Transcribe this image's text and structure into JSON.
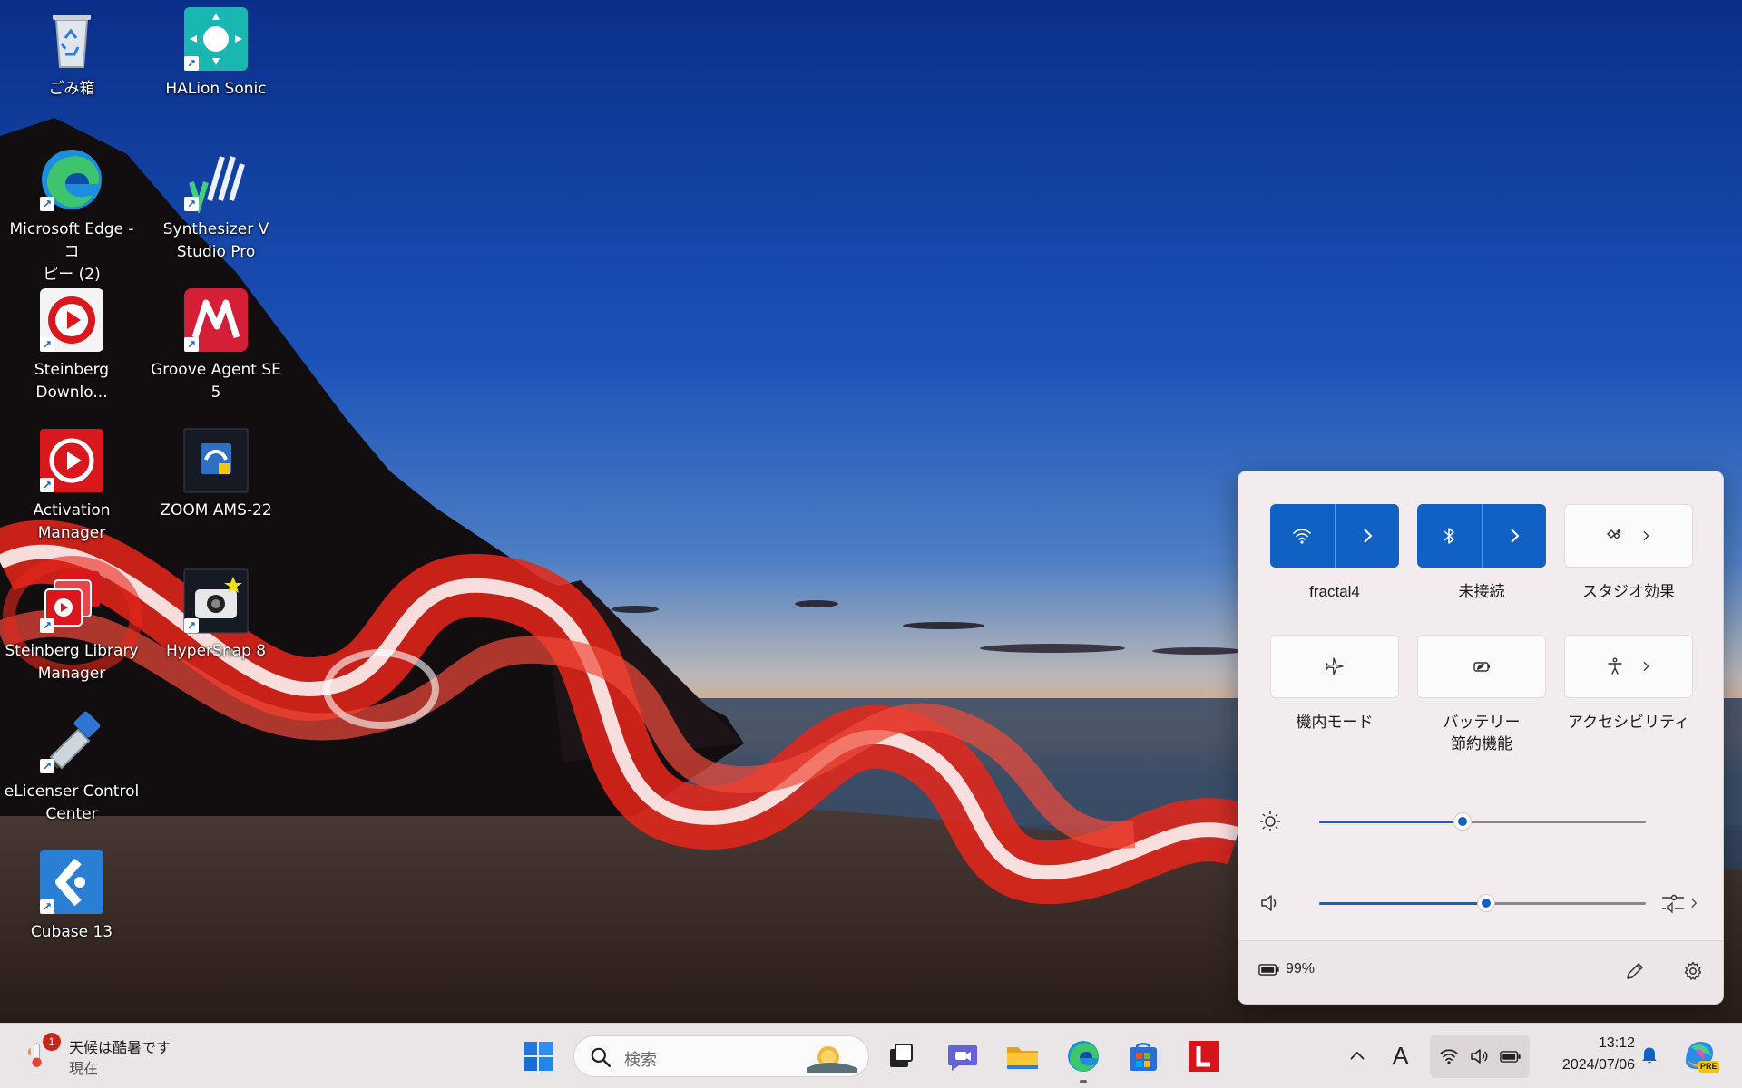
{
  "desktop": {
    "icons": [
      {
        "label": "ごみ箱",
        "icon": "recycle-bin-icon"
      },
      {
        "label": "HALion Sonic",
        "icon": "halion-sonic-icon"
      },
      {
        "label": "Microsoft Edge - コ\nピー (2)",
        "icon": "edge-icon"
      },
      {
        "label": "Synthesizer V\nStudio Pro",
        "icon": "synthesizer-v-icon"
      },
      {
        "label": "Steinberg\nDownlo...",
        "icon": "steinberg-download-icon"
      },
      {
        "label": "Groove Agent SE 5",
        "icon": "groove-agent-icon"
      },
      {
        "label": "Activation Manager",
        "icon": "activation-manager-icon"
      },
      {
        "label": "ZOOM AMS-22",
        "icon": "zoom-ams-icon"
      },
      {
        "label": "Steinberg Library\nManager",
        "icon": "steinberg-library-icon"
      },
      {
        "label": "HyperSnap 8",
        "icon": "hypersnap-icon"
      },
      {
        "label": "eLicenser Control\nCenter",
        "icon": "elicenser-icon"
      },
      {
        "label": "Cubase 13",
        "icon": "cubase-icon"
      }
    ]
  },
  "quick_settings": {
    "tiles": [
      {
        "label": "fractal4",
        "icon": "wifi-icon",
        "active": true
      },
      {
        "label": "未接続",
        "icon": "bluetooth-icon",
        "active": true
      },
      {
        "label": "スタジオ効果",
        "icon": "studio-effects-icon",
        "active": false
      },
      {
        "label": "機内モード",
        "icon": "airplane-icon",
        "active": false
      },
      {
        "label": "バッテリー\n節約機能",
        "icon": "battery-saver-icon",
        "active": false
      },
      {
        "label": "アクセシビリティ",
        "icon": "accessibility-icon",
        "active": false
      }
    ],
    "brightness": 0.44,
    "volume": 0.51,
    "battery_text": "99%"
  },
  "taskbar": {
    "weather_text": "天候は酷暑です",
    "weather_subtext": "現在",
    "weather_badge": "1",
    "search_placeholder": "検索",
    "tray_ime": "A",
    "clock_time": "13:12",
    "clock_date": "2024/07/06",
    "copilot_badge": "PRE"
  },
  "colors": {
    "accent": "#1160c4",
    "taskbar_bg": "#eae6e8",
    "flyout_bg": "#f2ecee"
  }
}
